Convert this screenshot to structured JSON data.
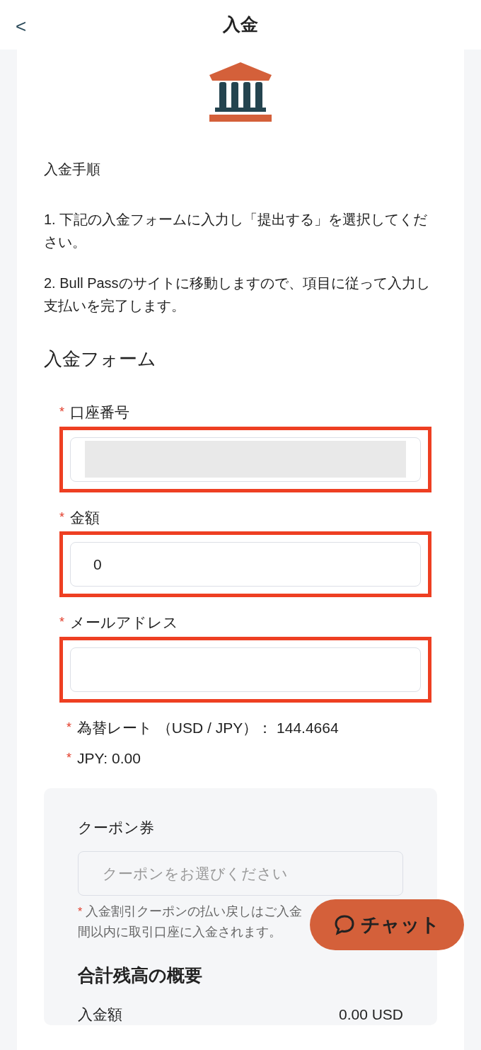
{
  "header": {
    "back_icon": "<",
    "title": "入金"
  },
  "procedure": {
    "title": "入金手順",
    "steps": [
      "1. 下記の入金フォームに入力し「提出する」を選択してください。",
      "2. Bull Passのサイトに移動しますので、項目に従って入力し支払いを完了します。"
    ]
  },
  "form": {
    "title": "入金フォーム",
    "fields": [
      {
        "label": "口座番号",
        "required_mark": "*",
        "highlighted": true,
        "masked": true
      },
      {
        "label": "金額",
        "required_mark": "*",
        "highlighted": true,
        "value": "0"
      },
      {
        "label": "メールアドレス",
        "required_mark": "*",
        "highlighted": true
      }
    ],
    "info": [
      {
        "required_mark": "*",
        "text": "為替レート （USD / JPY）：  144.4664"
      },
      {
        "required_mark": "*",
        "text": "JPY: 0.00"
      }
    ]
  },
  "coupon": {
    "label": "クーポン券",
    "placeholder": "クーポンをお選びください",
    "note_mark": "*",
    "note_lines": [
      "入金割引クーポンの払い戻しはご入金",
      "間以内に取引口座に入金されます。"
    ]
  },
  "summary": {
    "title": "合計残高の概要",
    "rows": [
      {
        "label": "入金額",
        "value": "0.00 USD"
      }
    ]
  },
  "chat_button": {
    "label": "チャット"
  }
}
